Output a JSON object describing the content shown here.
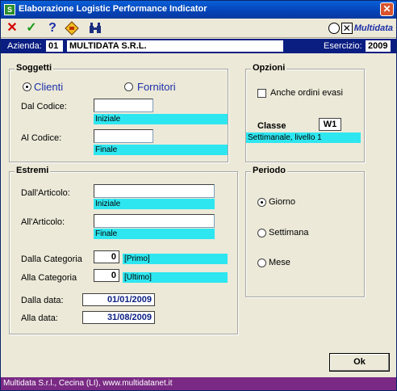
{
  "window": {
    "title": "Elaborazione Logistic Performance Indicator"
  },
  "toolbar": {
    "logo_text": "Multidata"
  },
  "info": {
    "azienda_label": "Azienda:",
    "azienda_code": "01",
    "azienda_name": "MULTIDATA S.R.L.",
    "esercizio_label": "Esercizio:",
    "esercizio_value": "2009"
  },
  "soggetti": {
    "title": "Soggetti",
    "clienti_label": "Clienti",
    "fornitori_label": "Fornitori",
    "dal_codice_label": "Dal Codice:",
    "dal_codice_value": "",
    "dal_codice_desc": "Iniziale",
    "al_codice_label": "Al Codice:",
    "al_codice_value": "",
    "al_codice_desc": "Finale"
  },
  "opzioni": {
    "title": "Opzioni",
    "anche_ordini_label": "Anche ordini evasi",
    "classe_label": "Classe",
    "classe_value": "W1",
    "classe_desc": "Settimanale, livello 1"
  },
  "estremi": {
    "title": "Estremi",
    "dall_articolo_label": "Dall'Articolo:",
    "dall_articolo_value": "",
    "dall_articolo_desc": "Iniziale",
    "all_articolo_label": "All'Articolo:",
    "all_articolo_value": "",
    "all_articolo_desc": "Finale",
    "dalla_categoria_label": "Dalla Categoria",
    "dalla_categoria_value": "0",
    "dalla_categoria_desc": "[Primo]",
    "alla_categoria_label": "Alla Categoria",
    "alla_categoria_value": "0",
    "alla_categoria_desc": "[Ultimo]",
    "dalla_data_label": "Dalla data:",
    "dalla_data_value": "01/01/2009",
    "alla_data_label": "Alla data:",
    "alla_data_value": "31/08/2009"
  },
  "periodo": {
    "title": "Periodo",
    "giorno_label": "Giorno",
    "settimana_label": "Settimana",
    "mese_label": "Mese"
  },
  "ok_label": "Ok",
  "status": "Multidata S.r.l., Cecina (LI), www.multidatanet.it",
  "colors": {
    "titlebar": "#0443b6",
    "infobar": "#0a1e82",
    "cyan_desc": "#2ee6f0",
    "statusbar": "#7a2a84"
  }
}
